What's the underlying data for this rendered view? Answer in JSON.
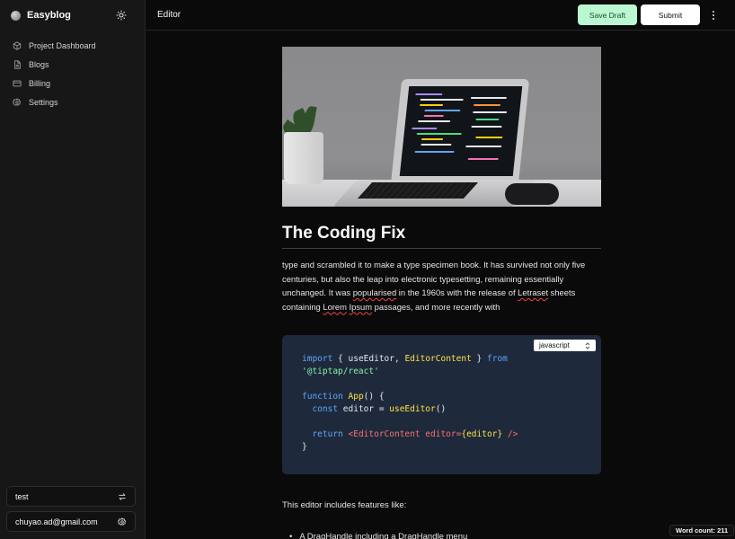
{
  "sidebar": {
    "brand": "Easyblog",
    "theme_icon": "sun-icon",
    "items": [
      {
        "label": "Project Dashboard",
        "icon": "box-icon"
      },
      {
        "label": "Blogs",
        "icon": "document-icon"
      },
      {
        "label": "Billing",
        "icon": "credit-card-icon"
      },
      {
        "label": "Settings",
        "icon": "gear-icon"
      }
    ],
    "project": {
      "name": "test",
      "icon": "switch-arrows-icon"
    },
    "user": {
      "email": "chuyao.ad@gmail.com",
      "icon": "gear-icon"
    }
  },
  "header": {
    "title": "Editor",
    "save_draft_label": "Save Draft",
    "submit_label": "Submit",
    "more_icon": "vertical-dots-icon"
  },
  "editor": {
    "image_alt": "Laptop with code on desk next to a potted plant",
    "title": "The Coding Fix",
    "paragraph": {
      "part1": "type and scrambled it to make a type specimen book. It has survived not only five centuries, but also the leap into electronic typesetting, remaining essentially unchanged. It was ",
      "w1": "popularised",
      "part2": " in the 1960s with the release of ",
      "w2": "Letraset",
      "part3": " sheets containing ",
      "w3": "Lorem",
      "part4": " ",
      "w4": "Ipsum",
      "part5": " passages, and more recently with"
    },
    "code": {
      "language": "javascript",
      "tokens": {
        "import": "import",
        "brace_open": " { ",
        "useEditor": "useEditor",
        "comma": ", ",
        "EditorContent": "EditorContent",
        "brace_close": " } ",
        "from": "from",
        "module": "'@tiptap/react'",
        "function": "function",
        "App": "App",
        "app_rest": "() {",
        "const": "const",
        "editor_decl": " editor = ",
        "useEditor_call": "useEditor",
        "call_rest": "()",
        "return": "return",
        "jsx_open": "<EditorContent editor=",
        "jsx_val": "{editor}",
        "jsx_close": " />",
        "end": "}"
      }
    },
    "after_text": "This editor includes features like:",
    "bullet": "A DragHandle including a DragHandle menu"
  },
  "status": {
    "word_count": "Word count: 211"
  },
  "colors": {
    "background": "#0a0a0a",
    "sidebar": "#171717",
    "save_draft_bg": "#bbf7d0",
    "code_bg": "#1e293b"
  }
}
